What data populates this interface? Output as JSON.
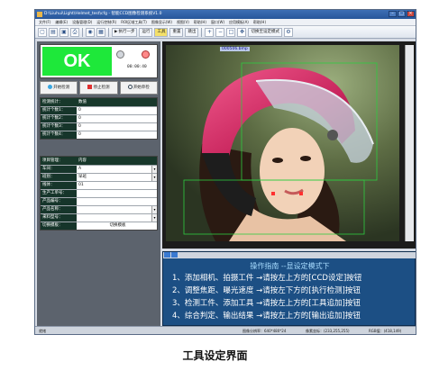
{
  "window": {
    "title": "D:\\Liuhui\\Light\\Helmet_test\\cfg - 智能CCD图像检测系统V1.0"
  },
  "menu": [
    "文件(F)",
    "编辑(E)",
    "设备管理(D)",
    "运行控制(R)",
    "ROI区域工具(T)",
    "图像显示(W)",
    "视图(V)",
    "帮助(H)",
    "窗口(W)",
    "应用模板(A)",
    "帮助(H)"
  ],
  "toolbar": {
    "run_label": "执行一步",
    "auto_label": "运行",
    "tool_label": "工具",
    "reset_label": "重置",
    "stop_label": "跳出",
    "compare_label": "切换至设定模式"
  },
  "status_panel": {
    "result": "OK",
    "timer": "00:00:40"
  },
  "buttons": {
    "start": "开始检测",
    "stop": "停止检测",
    "single": "开始单检"
  },
  "stats": {
    "header_key": "检测统计：",
    "header_val": "数值",
    "rows": [
      {
        "k": "统计个数1：",
        "v": "0"
      },
      {
        "k": "统计个数2：",
        "v": "0"
      },
      {
        "k": "统计个数3：",
        "v": "0"
      },
      {
        "k": "统计个数4：",
        "v": "0"
      }
    ]
  },
  "project": {
    "header_key": "项目管理：",
    "header_val": "内容",
    "rows": [
      {
        "k": "车间：",
        "v": "A"
      },
      {
        "k": "班别：",
        "v": "早班"
      },
      {
        "k": "线体：",
        "v": "01"
      },
      {
        "k": "生产工单号：",
        "v": ""
      },
      {
        "k": "产品编号：",
        "v": ""
      },
      {
        "k": "产品名称：",
        "v": ""
      },
      {
        "k": "来料型号：",
        "v": ""
      },
      {
        "k": "切换模板：",
        "v": "切换模板"
      }
    ]
  },
  "image": {
    "label": "000506.bmp"
  },
  "guide": {
    "title": "操作指南       --显设定模式下",
    "lines": [
      "1、添加相机、拍摄工件 →请按左上方的[CCD设定]按钮",
      "2、调整焦距、曝光速度 →请按左下方的[执行检测]按钮",
      "3、检测工件、添加工具 →请按左上方的[工具追加]按钮",
      "4、综合判定、输出结果 →请按左上方的[输出追加]按钮"
    ]
  },
  "statusbar": {
    "left": "就绪",
    "size": "图像分辨率：640*480*24",
    "coord": "像素坐标：(233,255,255)",
    "rgb": "RGB值：(418,149)"
  },
  "caption": "工具设定界面",
  "colors": {
    "ok_green": "#1ee83a",
    "guide_blue": "#1c4f84",
    "panel_dark": "#16352a"
  }
}
